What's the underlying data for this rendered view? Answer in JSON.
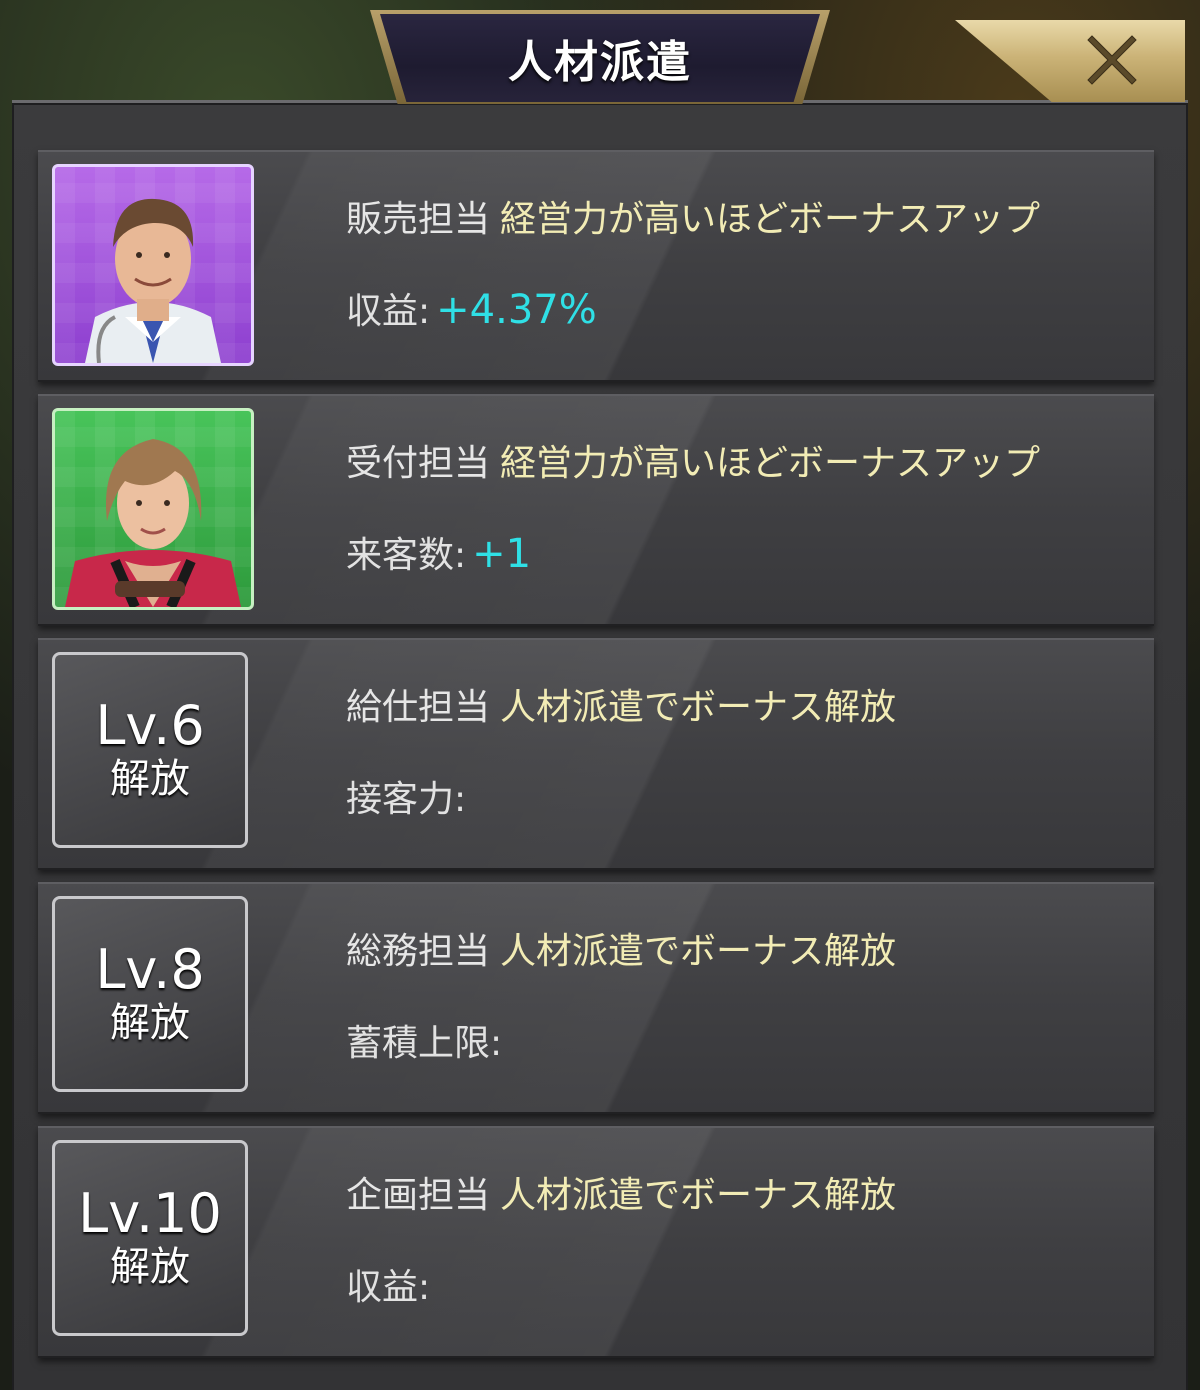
{
  "header": {
    "title": "人材派遣",
    "close_icon": "close-icon"
  },
  "colors": {
    "accent_gold": "#cbb377",
    "value_cyan": "#2fe0e6",
    "desc_yellow": "#f2ecb5"
  },
  "rows": [
    {
      "role": "販売担当",
      "description": "経営力が高いほどボーナスアップ",
      "stat_label": "収益:",
      "stat_value": "+4.37%",
      "avatar": "salesman-portrait"
    },
    {
      "role": "受付担当",
      "description": "経営力が高いほどボーナスアップ",
      "stat_label": "来客数:",
      "stat_value": "+1",
      "avatar": "receptionist-portrait"
    },
    {
      "role": "給仕担当",
      "description": "人材派遣でボーナス解放",
      "stat_label": "接客力:",
      "stat_value": "",
      "lock_level": "Lv.6",
      "lock_label": "解放"
    },
    {
      "role": "総務担当",
      "description": "人材派遣でボーナス解放",
      "stat_label": "蓄積上限:",
      "stat_value": "",
      "lock_level": "Lv.8",
      "lock_label": "解放"
    },
    {
      "role": "企画担当",
      "description": "人材派遣でボーナス解放",
      "stat_label": "収益:",
      "stat_value": "",
      "lock_level": "Lv.10",
      "lock_label": "解放"
    }
  ]
}
